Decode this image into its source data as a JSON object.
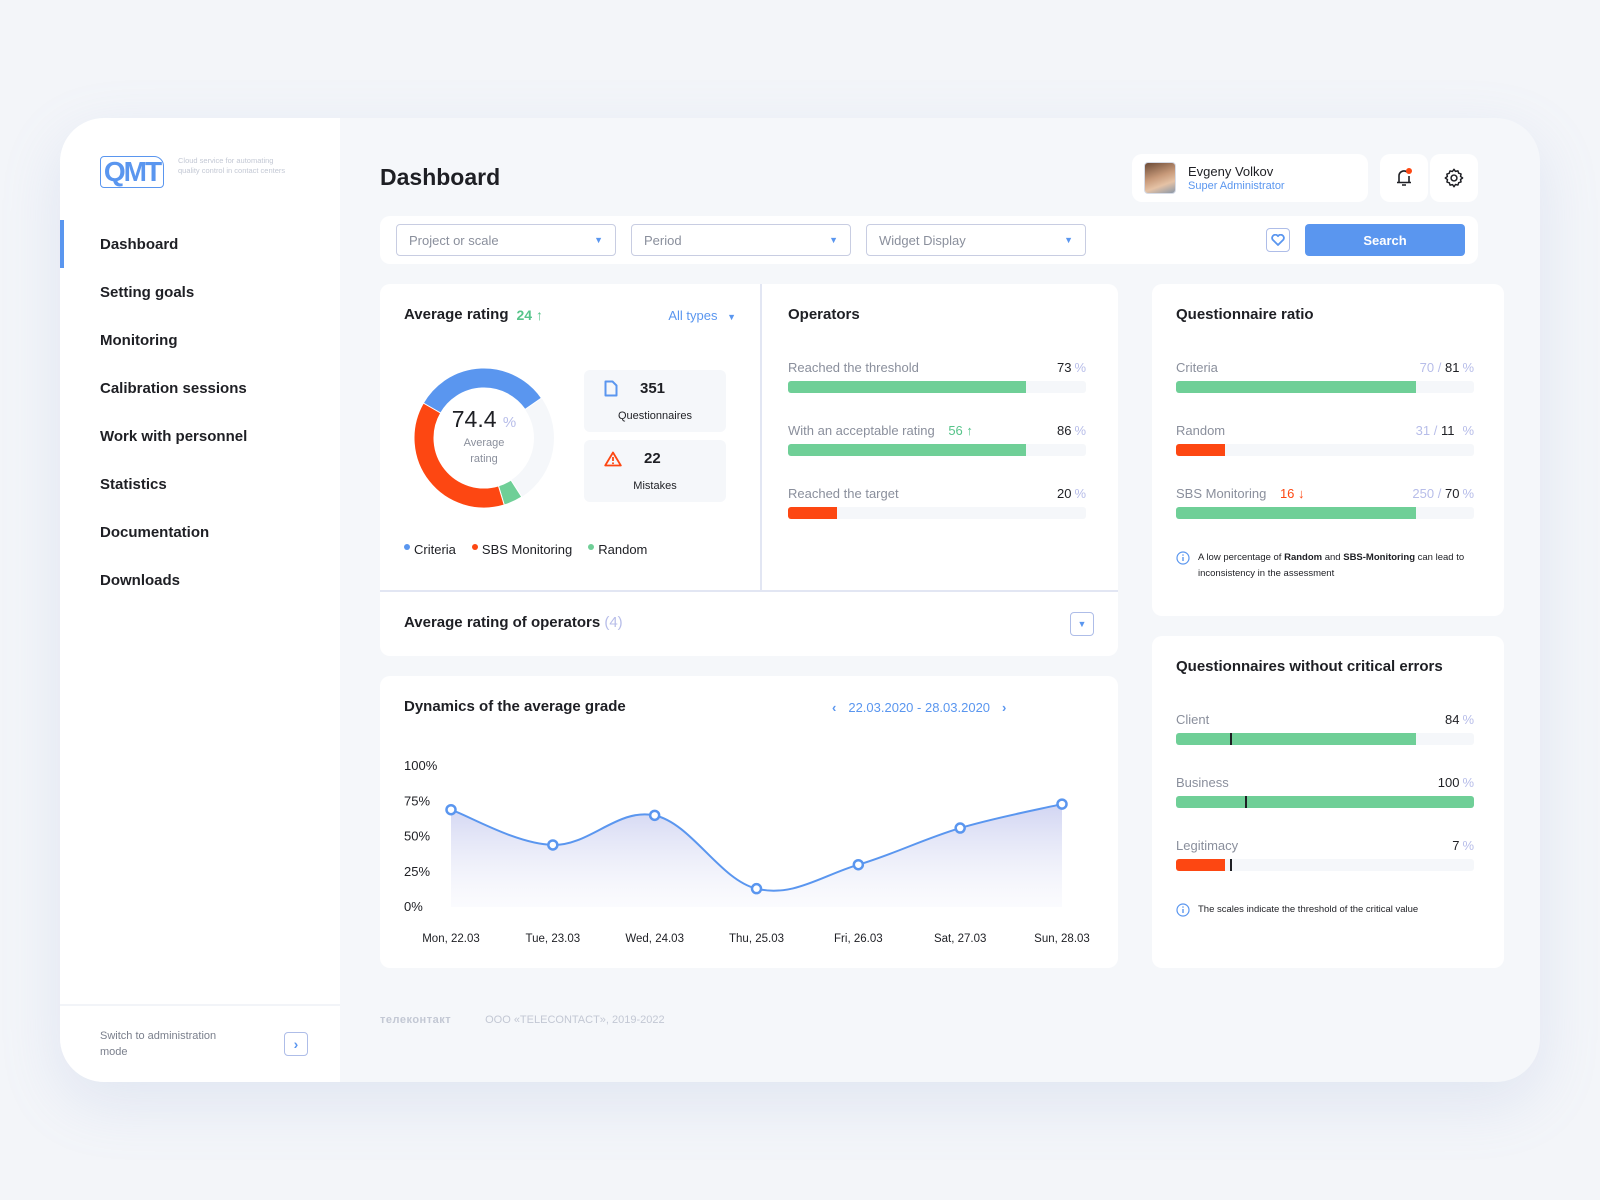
{
  "brand": {
    "logo": "QMT",
    "tagline": "Cloud service for automating quality control in contact centers"
  },
  "sidebar": {
    "items": [
      {
        "label": "Dashboard",
        "active": true
      },
      {
        "label": "Setting goals"
      },
      {
        "label": "Monitoring"
      },
      {
        "label": "Calibration sessions"
      },
      {
        "label": "Work with personnel"
      },
      {
        "label": "Statistics"
      },
      {
        "label": "Documentation"
      },
      {
        "label": "Downloads"
      }
    ],
    "footer": {
      "label": "Switch to administration mode",
      "icon": "chevron-right-icon"
    }
  },
  "header": {
    "title": "Dashboard",
    "user": {
      "name": "Evgeny Volkov",
      "role": "Super Administrator"
    },
    "notification_icon": "bell-icon",
    "notification_dot": true,
    "settings_icon": "gear-icon"
  },
  "filters": {
    "project": {
      "placeholder": "Project or scale"
    },
    "period": {
      "placeholder": "Period"
    },
    "widget": {
      "placeholder": "Widget Display"
    },
    "favorite_icon": "heart-icon",
    "search_label": "Search"
  },
  "average_rating": {
    "title": "Average rating",
    "delta": "24",
    "delta_dir": "up",
    "filter": "All types",
    "value": "74.4",
    "unit": "%",
    "value_label": "Average rating",
    "questionnaires": {
      "value": "351",
      "label": "Questionnaires"
    },
    "mistakes": {
      "value": "22",
      "label": "Mistakes"
    },
    "legend": [
      {
        "label": "Criteria",
        "color": "#5a96ef"
      },
      {
        "label": "SBS Monitoring",
        "color": "#fd4712"
      },
      {
        "label": "Random",
        "color": "#6fcf97"
      }
    ],
    "donut_segments": [
      {
        "label": "Criteria",
        "share": 0.32,
        "color": "#5a96ef"
      },
      {
        "label": "SBS Monitoring",
        "share": 0.38,
        "color": "#fd4712"
      },
      {
        "label": "Random",
        "share": 0.044,
        "color": "#6fcf97"
      }
    ]
  },
  "operators": {
    "title": "Operators",
    "rows": [
      {
        "label": "Reached the threshold",
        "value": "73",
        "fill": 0.8,
        "color": "green"
      },
      {
        "label": "With an acceptable rating",
        "delta": "56",
        "value": "86",
        "fill": 0.8,
        "color": "green"
      },
      {
        "label": "Reached the target",
        "value": "20",
        "fill": 0.165,
        "color": "red"
      }
    ],
    "unit": "%"
  },
  "avg_rating_operators": {
    "title": "Average rating of operators",
    "count": "(4)"
  },
  "dynamics": {
    "title": "Dynamics of the average grade",
    "date_range": "22.03.2020 - 28.03.2020"
  },
  "questionnaire_ratio": {
    "title": "Questionnaire ratio",
    "rows": [
      {
        "label": "Criteria",
        "total": "70",
        "value": "81",
        "fill": 0.805,
        "color": "green"
      },
      {
        "label": "Random",
        "total": "31",
        "value": "11",
        "fill": 0.165,
        "color": "red"
      },
      {
        "label": "SBS Monitoring",
        "delta": "16",
        "total": "250",
        "value": "70",
        "fill": 0.805,
        "color": "green"
      }
    ],
    "unit": "%",
    "note_parts": [
      "A low percentage of ",
      "Random",
      " and ",
      "SBS-Monitoring",
      " can lead to inconsistency in the assessment"
    ]
  },
  "no_critical_errors": {
    "title": "Questionnaires without critical errors",
    "rows": [
      {
        "label": "Client",
        "value": "84",
        "fill": 0.805,
        "threshold": 0.18,
        "color": "green"
      },
      {
        "label": "Business",
        "value": "100",
        "fill": 1.0,
        "threshold": 0.23,
        "color": "green"
      },
      {
        "label": "Legitimacy",
        "value": "7",
        "fill": 0.165,
        "threshold": 0.18,
        "color": "red"
      }
    ],
    "unit": "%",
    "note": "The scales indicate the threshold of the critical value"
  },
  "footer": {
    "brand": "телеконтакт",
    "copyright": "ООО «TELECONTACT», 2019-2022"
  },
  "chart_data": {
    "type": "area",
    "title": "Dynamics of the average grade",
    "x": [
      "Mon, 22.03",
      "Tue, 23.03",
      "Wed, 24.03",
      "Thu, 25.03",
      "Fri, 26.03",
      "Sat, 27.03",
      "Sun, 28.03"
    ],
    "series": [
      {
        "name": "Average grade",
        "values": [
          69,
          44,
          65,
          13,
          30,
          56,
          73
        ],
        "color": "#5a96ef"
      }
    ],
    "yticks": [
      "0%",
      "25%",
      "50%",
      "75%",
      "100%"
    ],
    "ylim": [
      0,
      100
    ],
    "xlabel": "",
    "ylabel": "",
    "grid": false,
    "legend": "none"
  }
}
